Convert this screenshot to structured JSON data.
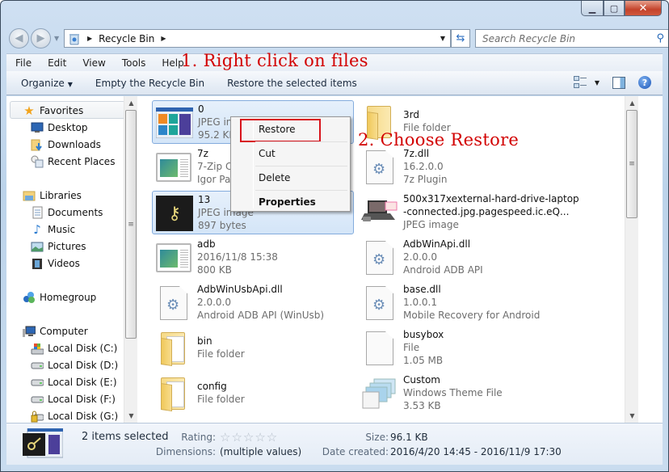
{
  "window": {
    "controls": {
      "minimize": "minimize",
      "maximize": "maximize",
      "close": "close"
    }
  },
  "navigation": {
    "back_icon": "back-arrow-icon",
    "forward_icon": "forward-arrow-icon",
    "address": {
      "icon": "recycle-bin-icon",
      "crumbs": [
        "Recycle Bin"
      ]
    },
    "refresh_icon": "refresh-icon",
    "search": {
      "placeholder": "Search Recycle Bin",
      "icon": "search-icon"
    }
  },
  "menubar": {
    "items": [
      "File",
      "Edit",
      "View",
      "Tools",
      "Help"
    ]
  },
  "annotations": {
    "step1": "1. Right click on files",
    "step2": "2. Choose Restore",
    "color": "#d20000"
  },
  "toolbar": {
    "organize": "Organize",
    "empty_bin": "Empty the Recycle Bin",
    "restore_selected": "Restore the selected items"
  },
  "sidebar": {
    "favorites": {
      "label": "Favorites",
      "items": [
        "Desktop",
        "Downloads",
        "Recent Places"
      ]
    },
    "libraries": {
      "label": "Libraries",
      "items": [
        "Documents",
        "Music",
        "Pictures",
        "Videos"
      ]
    },
    "homegroup": {
      "label": "Homegroup"
    },
    "computer": {
      "label": "Computer",
      "items": [
        "Local Disk (C:)",
        "Local Disk (D:)",
        "Local Disk (E:)",
        "Local Disk (F:)",
        "Local Disk (G:)"
      ]
    }
  },
  "files": [
    {
      "name": "0",
      "line2": "JPEG image",
      "line3": "95.2 KB",
      "selected": true,
      "icon": "jpeg-thumbnail"
    },
    {
      "name": "3rd",
      "line2": "File folder",
      "line3": "",
      "selected": false,
      "icon": "folder-icon"
    },
    {
      "name": "7z",
      "line2": "7-Zip Console",
      "line3": "Igor Pavlov",
      "selected": false,
      "icon": "application-icon"
    },
    {
      "name": "7z.dll",
      "line2": "16.2.0.0",
      "line3": "7z Plugin",
      "selected": false,
      "icon": "dll-icon"
    },
    {
      "name": "13",
      "line2": "JPEG image",
      "line3": "897 bytes",
      "selected": true,
      "icon": "key-thumbnail"
    },
    {
      "name": "500x317xexternal-hard-drive-laptop",
      "line2": "-connected.jpg.pagespeed.ic.eQ...",
      "line3": "JPEG image",
      "selected": false,
      "icon": "laptop-thumbnail"
    },
    {
      "name": "adb",
      "line2": "2016/11/8 15:38",
      "line3": "800 KB",
      "selected": false,
      "icon": "application-icon"
    },
    {
      "name": "AdbWinApi.dll",
      "line2": "2.0.0.0",
      "line3": "Android ADB API",
      "selected": false,
      "icon": "dll-icon"
    },
    {
      "name": "AdbWinUsbApi.dll",
      "line2": "2.0.0.0",
      "line3": "Android ADB API (WinUsb)",
      "selected": false,
      "icon": "dll-icon"
    },
    {
      "name": "base.dll",
      "line2": "1.0.0.1",
      "line3": "Mobile Recovery for Android",
      "selected": false,
      "icon": "dll-icon"
    },
    {
      "name": "bin",
      "line2": "File folder",
      "line3": "",
      "selected": false,
      "icon": "folder-icon"
    },
    {
      "name": "busybox",
      "line2": "File",
      "line3": "1.05 MB",
      "selected": false,
      "icon": "blank-file-icon"
    },
    {
      "name": "config",
      "line2": "File folder",
      "line3": "",
      "selected": false,
      "icon": "folder-icon"
    },
    {
      "name": "Custom",
      "line2": "Windows Theme File",
      "line3": "3.53 KB",
      "selected": false,
      "icon": "theme-file-icon"
    }
  ],
  "context_menu": {
    "items": [
      "Restore",
      "Cut",
      "Delete",
      "Properties"
    ],
    "highlighted": "Restore",
    "default": "Properties"
  },
  "details_pane": {
    "summary": "2 items selected",
    "rating_label": "Rating:",
    "rating_stars": 0,
    "rating_max": 5,
    "dimensions_label": "Dimensions:",
    "dimensions_value": "(multiple values)",
    "size_label": "Size:",
    "size_value": "96.1 KB",
    "date_label": "Date created:",
    "date_value": "2016/4/20 14:45 - 2016/11/9 17:30"
  }
}
